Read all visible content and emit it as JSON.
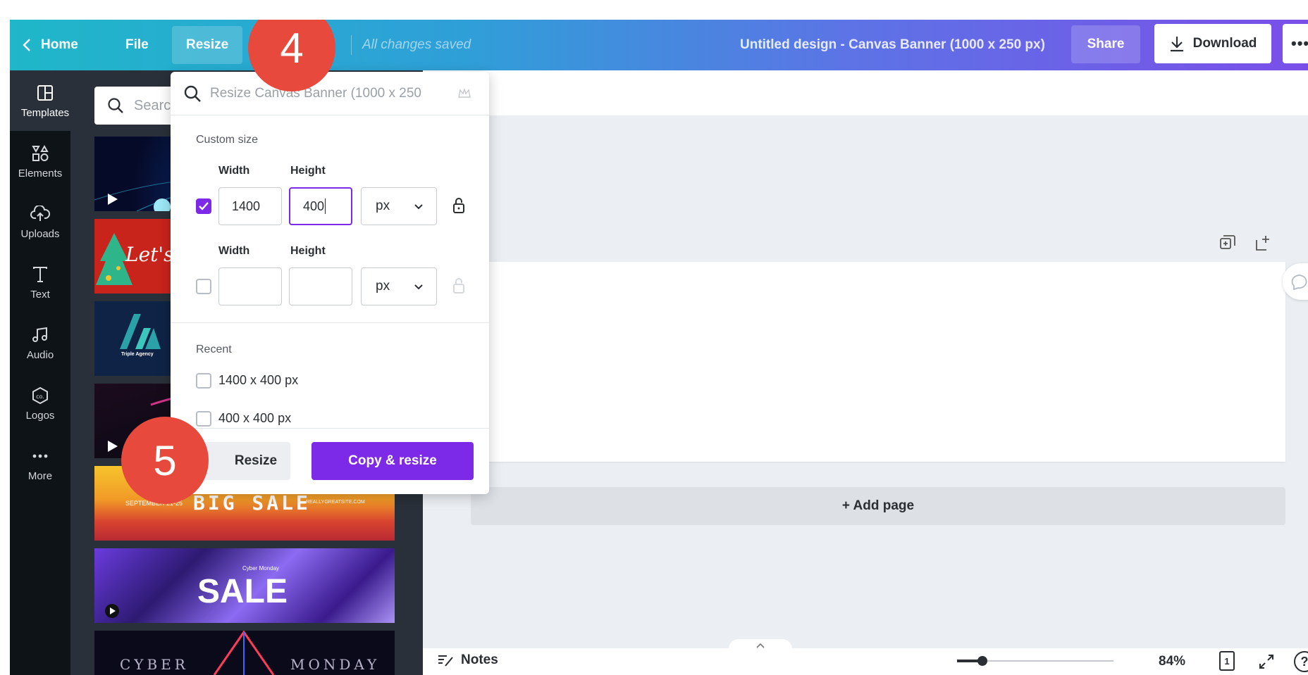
{
  "topbar": {
    "home_label": "Home",
    "file_label": "File",
    "resize_label": "Resize",
    "saved_status": "All changes saved",
    "design_title": "Untitled design - Canvas Banner (1000 x 250 px)",
    "share_label": "Share",
    "download_label": "Download",
    "more_label": "•••"
  },
  "rail": {
    "items": [
      {
        "label": "Templates",
        "icon": "templates-icon"
      },
      {
        "label": "Elements",
        "icon": "elements-icon"
      },
      {
        "label": "Uploads",
        "icon": "uploads-icon"
      },
      {
        "label": "Text",
        "icon": "text-icon"
      },
      {
        "label": "Audio",
        "icon": "audio-icon"
      },
      {
        "label": "Logos",
        "icon": "logos-icon"
      },
      {
        "label": "More",
        "icon": "more-icon"
      }
    ]
  },
  "panel": {
    "search_placeholder": "Searc",
    "thumbs": [
      {
        "text": ""
      },
      {
        "text": "Let's m"
      },
      {
        "text": "Triple Agency"
      },
      {
        "text": ""
      },
      {
        "text": "BIG SALE",
        "subtext": "SEPTEMBER 21-25",
        "url_text": "REALLYGREATSITE.COM"
      },
      {
        "text": "SALE",
        "subtext": "Cyber Monday"
      },
      {
        "text_left": "CYBER",
        "text_right": "MONDAY"
      }
    ]
  },
  "dropdown": {
    "search_placeholder": "Resize Canvas Banner (1000 x 250",
    "custom_size_label": "Custom size",
    "row1": {
      "width_label": "Width",
      "height_label": "Height",
      "width_value": "1400",
      "height_value": "400",
      "unit": "px",
      "checked": true
    },
    "row2": {
      "width_label": "Width",
      "height_label": "Height",
      "width_value": "",
      "height_value": "",
      "unit": "px",
      "checked": false
    },
    "recent_label": "Recent",
    "recent": [
      "1400 x 400 px",
      "400 x 400 px"
    ],
    "resize_button": "Resize",
    "copy_resize_button": "Copy & resize"
  },
  "canvas": {
    "add_page_label": "+ Add page"
  },
  "footer": {
    "notes_label": "Notes",
    "zoom": "84%",
    "page_count": "1",
    "help": "?",
    "zoom_slider_fraction": 0.16
  },
  "badges": {
    "step4": "4",
    "step5": "5"
  },
  "colors": {
    "accent": "#7d2ae8",
    "badge": "#e8493d",
    "rail_bg": "#0e1318",
    "panel_bg": "#293039"
  }
}
